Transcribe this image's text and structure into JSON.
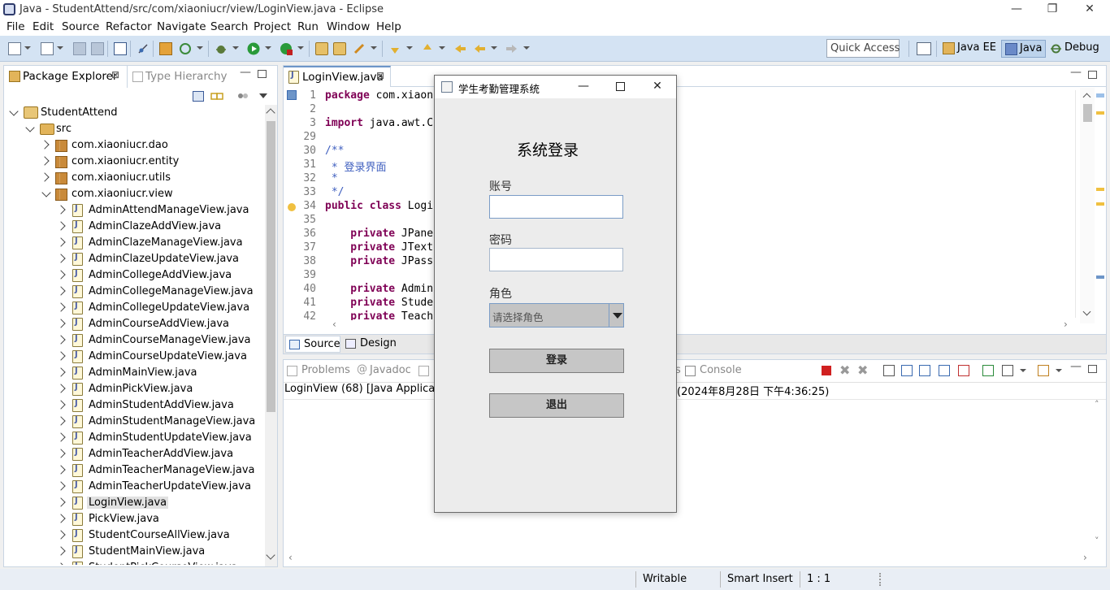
{
  "window": {
    "title": "Java - StudentAttend/src/com/xiaoniucr/view/LoginView.java - Eclipse",
    "minimize": "—",
    "maximize": "❐",
    "close": "✕"
  },
  "menu": [
    "File",
    "Edit",
    "Source",
    "Refactor",
    "Navigate",
    "Search",
    "Project",
    "Run",
    "Window",
    "Help"
  ],
  "toolbar": {
    "quick_access_placeholder": "Quick Access",
    "perspectives": [
      "Java EE",
      "Java",
      "Debug"
    ]
  },
  "package_explorer": {
    "tab_label": "Package Explorer",
    "tab2_label": "Type Hierarchy",
    "project": "StudentAttend",
    "src": "src",
    "packages": [
      "com.xiaoniucr.dao",
      "com.xiaoniucr.entity",
      "com.xiaoniucr.utils",
      "com.xiaoniucr.view"
    ],
    "files": [
      "AdminAttendManageView.java",
      "AdminClazeAddView.java",
      "AdminClazeManageView.java",
      "AdminClazeUpdateView.java",
      "AdminCollegeAddView.java",
      "AdminCollegeManageView.java",
      "AdminCollegeUpdateView.java",
      "AdminCourseAddView.java",
      "AdminCourseManageView.java",
      "AdminCourseUpdateView.java",
      "AdminMainView.java",
      "AdminPickView.java",
      "AdminStudentAddView.java",
      "AdminStudentManageView.java",
      "AdminStudentUpdateView.java",
      "AdminTeacherAddView.java",
      "AdminTeacherManageView.java",
      "AdminTeacherUpdateView.java",
      "LoginView.java",
      "PickView.java",
      "StudentCourseAllView.java",
      "StudentMainView.java",
      "StudentPickCourseView.java"
    ],
    "selected_file": "LoginView.java"
  },
  "editor": {
    "tab_label": "LoginView.java",
    "lines": [
      {
        "n": "1",
        "kw": "package",
        "rest": " com.xiaon"
      },
      {
        "n": "2",
        "kw": "",
        "rest": ""
      },
      {
        "n": "3",
        "kw": "import",
        "rest": " java.awt.C"
      },
      {
        "n": "29",
        "kw": "",
        "rest": ""
      },
      {
        "n": "30",
        "kw": "",
        "rest": "/**",
        "comment": true
      },
      {
        "n": "31",
        "kw": "",
        "rest": " * 登录界面",
        "comment": true
      },
      {
        "n": "32",
        "kw": "",
        "rest": " *",
        "comment": true
      },
      {
        "n": "33",
        "kw": "",
        "rest": " */",
        "comment": true
      },
      {
        "n": "34",
        "kw": "public class",
        "rest": " Logi"
      },
      {
        "n": "35",
        "kw": "",
        "rest": ""
      },
      {
        "n": "36",
        "kw": "    private",
        "rest": " JPane"
      },
      {
        "n": "37",
        "kw": "    private",
        "rest": " JText"
      },
      {
        "n": "38",
        "kw": "    private",
        "rest": " JPass"
      },
      {
        "n": "39",
        "kw": "",
        "rest": ""
      },
      {
        "n": "40",
        "kw": "    private",
        "rest": " Admin"
      },
      {
        "n": "41",
        "kw": "    private",
        "rest": " Stude"
      },
      {
        "n": "42",
        "kw": "    private",
        "rest": " Teach"
      }
    ],
    "source_tab": "Source",
    "design_tab": "Design"
  },
  "console": {
    "tabs": [
      "Problems",
      "Javadoc",
      "Console"
    ],
    "launch_left": "LoginView (68) [Java Application",
    "launch_right": "(2024年8月28日 下午4:36:25)"
  },
  "statusbar": {
    "writable": "Writable",
    "insert_mode": "Smart Insert",
    "position": "1 : 1"
  },
  "dialog": {
    "title": "学生考勤管理系统",
    "heading": "系统登录",
    "account_label": "账号",
    "account_value": "",
    "password_label": "密码",
    "password_value": "",
    "role_label": "角色",
    "role_selected": "请选择角色",
    "login_button": "登录",
    "exit_button": "退出"
  },
  "colors": {
    "toolbar_bg": "#d4e3f3",
    "keyword": "#7f0055",
    "comment": "#3f5fbf",
    "dialog_bg": "#ececec"
  }
}
